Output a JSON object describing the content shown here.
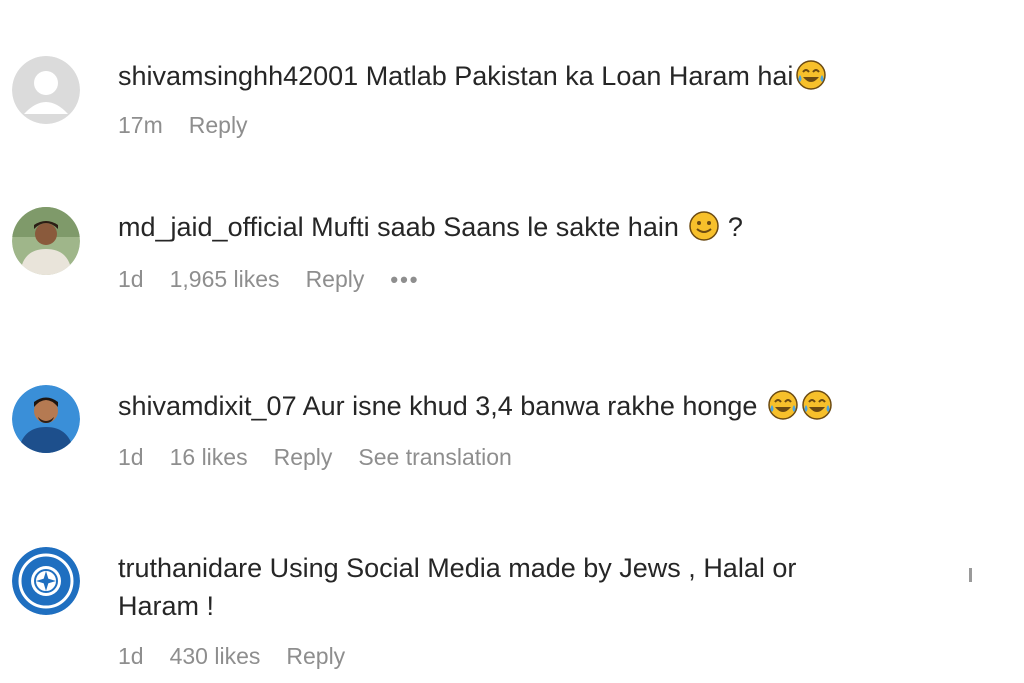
{
  "comments": [
    {
      "username": "shivamsinghh42001",
      "text": "Matlab Pakistan ka Loan Haram hai",
      "emoji": [
        "tears-of-joy"
      ],
      "time": "17m",
      "likes": "",
      "reply": "Reply",
      "extra": ""
    },
    {
      "username": "md_jaid_official",
      "text": "Mufti saab Saans le sakte hain",
      "emoji": [
        "slight-smile"
      ],
      "suffix": "?",
      "time": "1d",
      "likes": "1,965 likes",
      "reply": "Reply",
      "more": "•••"
    },
    {
      "username": "shivamdixit_07",
      "text": "Aur isne khud 3,4 banwa rakhe honge",
      "emoji": [
        "tears-of-joy",
        "tears-of-joy"
      ],
      "time": "1d",
      "likes": "16 likes",
      "reply": "Reply",
      "extra": "See translation"
    },
    {
      "username": "truthanidare",
      "text": "Using Social Media made by Jews , Halal or Haram !",
      "emoji": [],
      "time": "1d",
      "likes": "430 likes",
      "reply": "Reply",
      "extra": ""
    }
  ],
  "colors": {
    "text": "#262626",
    "meta": "#8e8e8e",
    "emoji_face": "#f7c02b",
    "truth_avatar": "#1f6fc0"
  }
}
